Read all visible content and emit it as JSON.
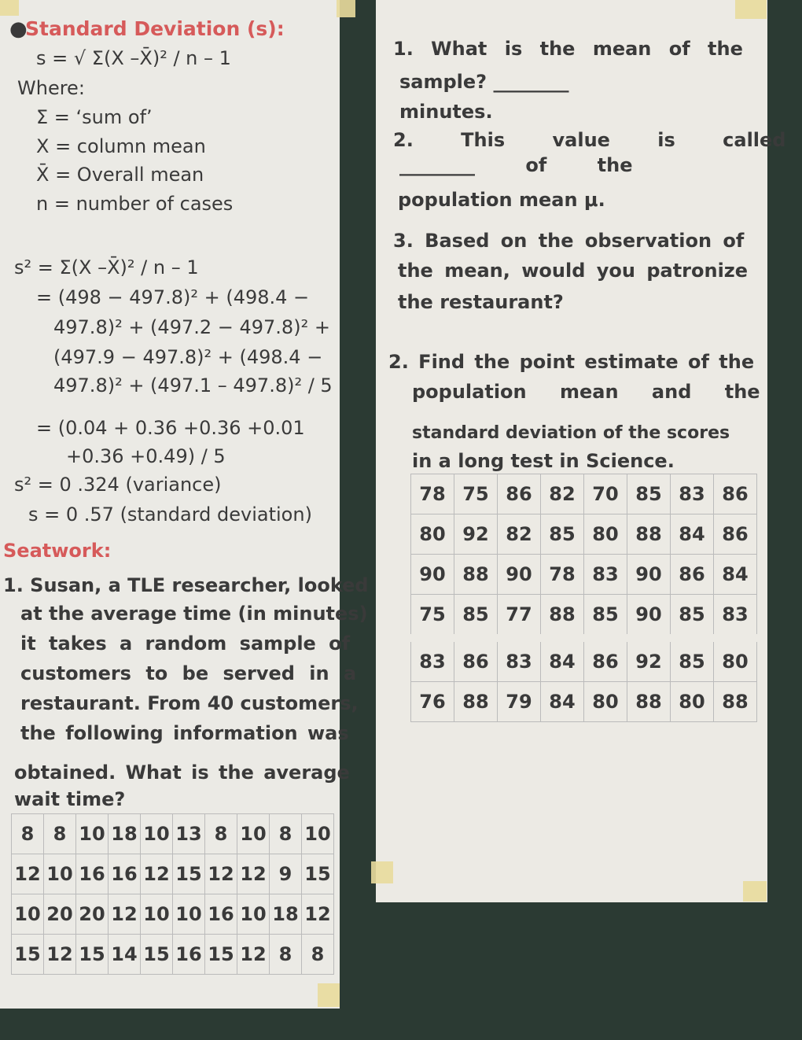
{
  "left": {
    "heading": "Standard Deviation (s):",
    "formula": "s = √ Σ(X –X̄)² / n – 1",
    "where": "Where:",
    "defs": [
      "Σ = ‘sum of’",
      "X = column mean",
      "X̄ = Overall mean",
      "n = number of cases"
    ],
    "calc": [
      "s² = Σ(X –X̄)² / n – 1",
      "= (498 − 497.8)² + (498.4 −",
      "497.8)² + (497.2 − 497.8)² +",
      "(497.9 − 497.8)² + (498.4 −",
      "497.8)² + (497.1 – 497.8)² / 5",
      "= (0.04 + 0.36 +0.36 +0.01",
      "+0.36 +0.49) / 5",
      "s² = 0 .324 (variance)",
      "s = 0 .57 (standard deviation)"
    ],
    "seatwork": "Seatwork:",
    "problem": [
      "1. Susan, a TLE researcher, looked",
      "at the average time (in minutes)",
      "it takes a random sample of",
      "customers to be served in a",
      "restaurant. From 40 customers,",
      "the following information was",
      "obtained. What is the average",
      "wait time?"
    ],
    "table": [
      [
        "8",
        "8",
        "10",
        "18",
        "10",
        "13",
        "8",
        "10",
        "8",
        "10"
      ],
      [
        "12",
        "10",
        "16",
        "16",
        "12",
        "15",
        "12",
        "12",
        "9",
        "15"
      ],
      [
        "10",
        "20",
        "20",
        "12",
        "10",
        "10",
        "16",
        "10",
        "18",
        "12"
      ],
      [
        "15",
        "12",
        "15",
        "14",
        "15",
        "16",
        "15",
        "12",
        "8",
        "8"
      ]
    ]
  },
  "right": {
    "lines": [
      "1. What is the mean of the",
      "sample? ________",
      "minutes.",
      "2. This value is called",
      "________ of the",
      "population mean μ.",
      "3. Based on the observation of",
      "the mean, would you patronize",
      "the restaurant?",
      "2. Find the point estimate of the",
      "population mean and the",
      "standard deviation of the scores",
      "in a long test in Science."
    ],
    "table": [
      [
        "78",
        "75",
        "86",
        "82",
        "70",
        "85",
        "83",
        "86"
      ],
      [
        "80",
        "92",
        "82",
        "85",
        "80",
        "88",
        "84",
        "86"
      ],
      [
        "90",
        "88",
        "90",
        "78",
        "83",
        "90",
        "86",
        "84"
      ],
      [
        "75",
        "85",
        "77",
        "88",
        "85",
        "90",
        "85",
        "83"
      ],
      [
        "83",
        "86",
        "83",
        "84",
        "86",
        "92",
        "85",
        "80"
      ],
      [
        "76",
        "88",
        "79",
        "84",
        "80",
        "88",
        "80",
        "88"
      ]
    ]
  },
  "colors": {
    "heading": "#d65a5a",
    "board": "#2b3a33",
    "paper": "#ebeae5",
    "tape": "#e9dc9c"
  }
}
